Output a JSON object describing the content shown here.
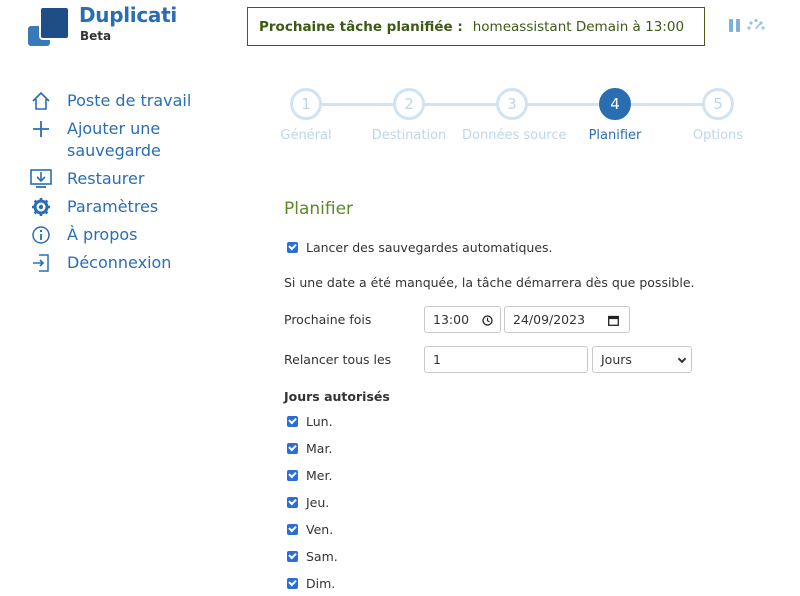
{
  "header": {
    "brand": "Duplicati",
    "brand_sub": "Beta",
    "banner_label": "Prochaine tâche planifiée :",
    "banner_value": "homeassistant Demain à 13:00",
    "pause_icon": "pause-icon",
    "throttle_icon": "speed-throttle-icon"
  },
  "sidebar": {
    "items": [
      {
        "label": "Poste de travail",
        "icon": "home-icon"
      },
      {
        "label": "Ajouter une sauvegarde",
        "icon": "plus-icon"
      },
      {
        "label": "Restaurer",
        "icon": "restore-icon"
      },
      {
        "label": "Paramètres",
        "icon": "gear-icon"
      },
      {
        "label": "À propos",
        "icon": "info-icon"
      },
      {
        "label": "Déconnexion",
        "icon": "logout-icon"
      }
    ]
  },
  "steps": [
    {
      "num": "1",
      "label": "Général",
      "active": false
    },
    {
      "num": "2",
      "label": "Destination",
      "active": false
    },
    {
      "num": "3",
      "label": "Données source",
      "active": false
    },
    {
      "num": "4",
      "label": "Planifier",
      "active": true
    },
    {
      "num": "5",
      "label": "Options",
      "active": false
    }
  ],
  "form": {
    "title": "Planifier",
    "auto_label": "Lancer des sauvegardes automatiques.",
    "auto_checked": true,
    "missed_note": "Si une date a été manquée, la tâche démarrera dès que possible.",
    "next_label": "Prochaine fois",
    "next_time": "13:00",
    "next_date": "24/09/2023",
    "repeat_label": "Relancer tous les",
    "repeat_value": "1",
    "repeat_unit": "Jours",
    "days_label": "Jours autorisés",
    "days": [
      {
        "label": "Lun.",
        "checked": true
      },
      {
        "label": "Mar.",
        "checked": true
      },
      {
        "label": "Mer.",
        "checked": true
      },
      {
        "label": "Jeu.",
        "checked": true
      },
      {
        "label": "Ven.",
        "checked": true
      },
      {
        "label": "Sam.",
        "checked": true
      },
      {
        "label": "Dim.",
        "checked": true
      }
    ]
  },
  "colors": {
    "primary": "#2a6eb2",
    "step_inactive": "#cfe3f4",
    "title_green": "#5b8a2c",
    "banner_border": "#4a5a1c",
    "checkbox": "#2b6fd6"
  }
}
